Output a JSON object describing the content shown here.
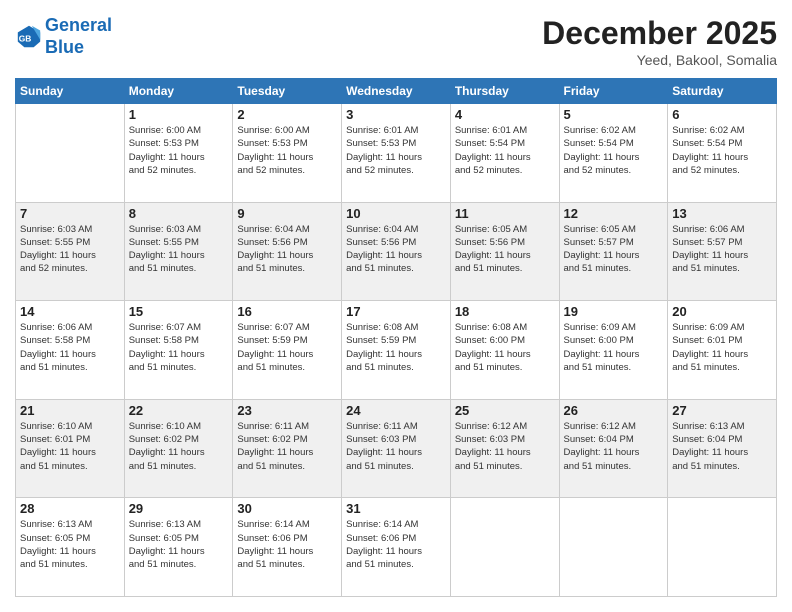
{
  "header": {
    "logo_line1": "General",
    "logo_line2": "Blue",
    "title": "December 2025",
    "subtitle": "Yeed, Bakool, Somalia"
  },
  "calendar": {
    "days_of_week": [
      "Sunday",
      "Monday",
      "Tuesday",
      "Wednesday",
      "Thursday",
      "Friday",
      "Saturday"
    ],
    "weeks": [
      [
        {
          "day": "",
          "info": ""
        },
        {
          "day": "1",
          "info": "Sunrise: 6:00 AM\nSunset: 5:53 PM\nDaylight: 11 hours\nand 52 minutes."
        },
        {
          "day": "2",
          "info": "Sunrise: 6:00 AM\nSunset: 5:53 PM\nDaylight: 11 hours\nand 52 minutes."
        },
        {
          "day": "3",
          "info": "Sunrise: 6:01 AM\nSunset: 5:53 PM\nDaylight: 11 hours\nand 52 minutes."
        },
        {
          "day": "4",
          "info": "Sunrise: 6:01 AM\nSunset: 5:54 PM\nDaylight: 11 hours\nand 52 minutes."
        },
        {
          "day": "5",
          "info": "Sunrise: 6:02 AM\nSunset: 5:54 PM\nDaylight: 11 hours\nand 52 minutes."
        },
        {
          "day": "6",
          "info": "Sunrise: 6:02 AM\nSunset: 5:54 PM\nDaylight: 11 hours\nand 52 minutes."
        }
      ],
      [
        {
          "day": "7",
          "info": "Sunrise: 6:03 AM\nSunset: 5:55 PM\nDaylight: 11 hours\nand 52 minutes."
        },
        {
          "day": "8",
          "info": "Sunrise: 6:03 AM\nSunset: 5:55 PM\nDaylight: 11 hours\nand 51 minutes."
        },
        {
          "day": "9",
          "info": "Sunrise: 6:04 AM\nSunset: 5:56 PM\nDaylight: 11 hours\nand 51 minutes."
        },
        {
          "day": "10",
          "info": "Sunrise: 6:04 AM\nSunset: 5:56 PM\nDaylight: 11 hours\nand 51 minutes."
        },
        {
          "day": "11",
          "info": "Sunrise: 6:05 AM\nSunset: 5:56 PM\nDaylight: 11 hours\nand 51 minutes."
        },
        {
          "day": "12",
          "info": "Sunrise: 6:05 AM\nSunset: 5:57 PM\nDaylight: 11 hours\nand 51 minutes."
        },
        {
          "day": "13",
          "info": "Sunrise: 6:06 AM\nSunset: 5:57 PM\nDaylight: 11 hours\nand 51 minutes."
        }
      ],
      [
        {
          "day": "14",
          "info": "Sunrise: 6:06 AM\nSunset: 5:58 PM\nDaylight: 11 hours\nand 51 minutes."
        },
        {
          "day": "15",
          "info": "Sunrise: 6:07 AM\nSunset: 5:58 PM\nDaylight: 11 hours\nand 51 minutes."
        },
        {
          "day": "16",
          "info": "Sunrise: 6:07 AM\nSunset: 5:59 PM\nDaylight: 11 hours\nand 51 minutes."
        },
        {
          "day": "17",
          "info": "Sunrise: 6:08 AM\nSunset: 5:59 PM\nDaylight: 11 hours\nand 51 minutes."
        },
        {
          "day": "18",
          "info": "Sunrise: 6:08 AM\nSunset: 6:00 PM\nDaylight: 11 hours\nand 51 minutes."
        },
        {
          "day": "19",
          "info": "Sunrise: 6:09 AM\nSunset: 6:00 PM\nDaylight: 11 hours\nand 51 minutes."
        },
        {
          "day": "20",
          "info": "Sunrise: 6:09 AM\nSunset: 6:01 PM\nDaylight: 11 hours\nand 51 minutes."
        }
      ],
      [
        {
          "day": "21",
          "info": "Sunrise: 6:10 AM\nSunset: 6:01 PM\nDaylight: 11 hours\nand 51 minutes."
        },
        {
          "day": "22",
          "info": "Sunrise: 6:10 AM\nSunset: 6:02 PM\nDaylight: 11 hours\nand 51 minutes."
        },
        {
          "day": "23",
          "info": "Sunrise: 6:11 AM\nSunset: 6:02 PM\nDaylight: 11 hours\nand 51 minutes."
        },
        {
          "day": "24",
          "info": "Sunrise: 6:11 AM\nSunset: 6:03 PM\nDaylight: 11 hours\nand 51 minutes."
        },
        {
          "day": "25",
          "info": "Sunrise: 6:12 AM\nSunset: 6:03 PM\nDaylight: 11 hours\nand 51 minutes."
        },
        {
          "day": "26",
          "info": "Sunrise: 6:12 AM\nSunset: 6:04 PM\nDaylight: 11 hours\nand 51 minutes."
        },
        {
          "day": "27",
          "info": "Sunrise: 6:13 AM\nSunset: 6:04 PM\nDaylight: 11 hours\nand 51 minutes."
        }
      ],
      [
        {
          "day": "28",
          "info": "Sunrise: 6:13 AM\nSunset: 6:05 PM\nDaylight: 11 hours\nand 51 minutes."
        },
        {
          "day": "29",
          "info": "Sunrise: 6:13 AM\nSunset: 6:05 PM\nDaylight: 11 hours\nand 51 minutes."
        },
        {
          "day": "30",
          "info": "Sunrise: 6:14 AM\nSunset: 6:06 PM\nDaylight: 11 hours\nand 51 minutes."
        },
        {
          "day": "31",
          "info": "Sunrise: 6:14 AM\nSunset: 6:06 PM\nDaylight: 11 hours\nand 51 minutes."
        },
        {
          "day": "",
          "info": ""
        },
        {
          "day": "",
          "info": ""
        },
        {
          "day": "",
          "info": ""
        }
      ]
    ]
  }
}
